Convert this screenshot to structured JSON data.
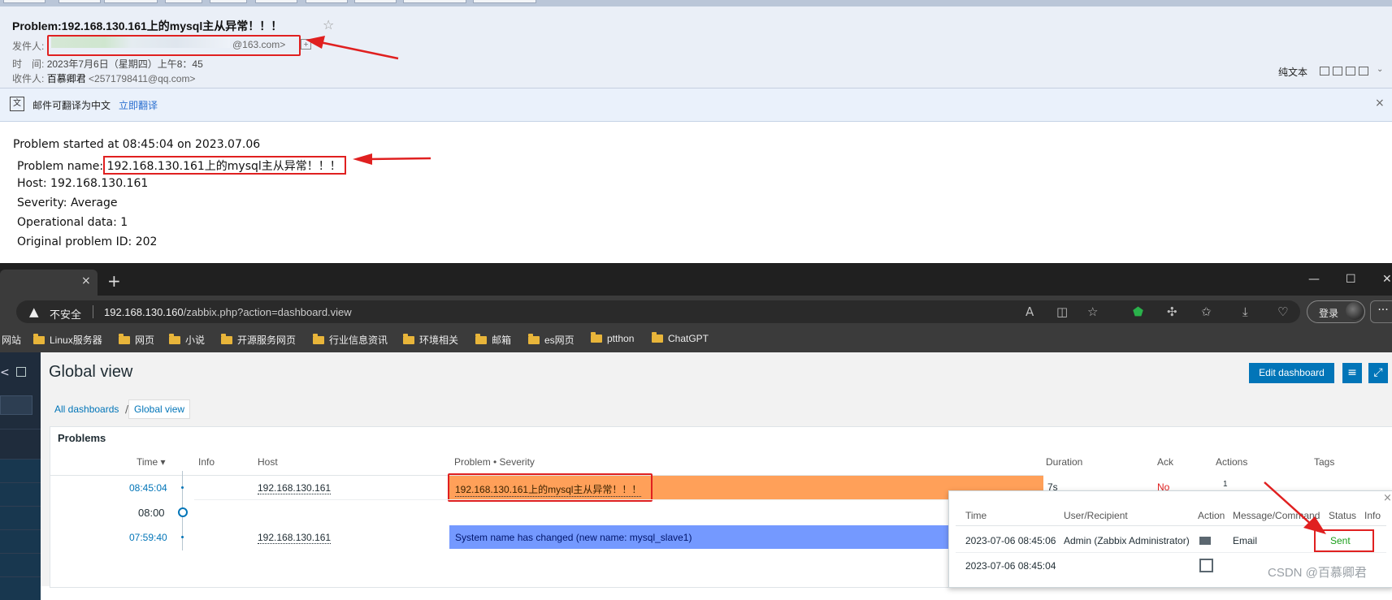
{
  "email": {
    "subject": "Problem:192.168.130.161上的mysql主从异常！！！",
    "star_icon": "☆",
    "from_label": "发件人:",
    "from_email": "@163.com>",
    "time_label": "时　间:",
    "time_value": "2023年7月6日（星期四）上午8：45",
    "to_label": "收件人:",
    "to_name": "百慕卿君",
    "to_email": "<2571798411@qq.com>",
    "plain_text": "纯文本",
    "translate_text": "邮件可翻译为中文",
    "translate_link": "立即翻译",
    "close_icon": "×",
    "body": {
      "started": "Problem started at 08:45:04 on 2023.07.06",
      "name_label": "Problem name: ",
      "name_value": "192.168.130.161上的mysql主从异常！！！",
      "host": "Host: 192.168.130.161",
      "severity": "Severity: Average",
      "opdata": "Operational data: 1",
      "original_id": "Original problem ID: 202"
    }
  },
  "browser": {
    "tab_close": "×",
    "new_tab": "+",
    "minimize": "—",
    "maximize": "☐",
    "close": "✕",
    "insecure_label": "不安全",
    "url_host": "192.168.130.160",
    "url_path": "/zabbix.php?action=dashboard.view",
    "login_label": "登录",
    "more_label": "···",
    "bookmarks": [
      "网站",
      "Linux服务器",
      "网页",
      "小说",
      "开源服务网页",
      "行业信息资讯",
      "环境相关",
      "邮箱",
      "es网页",
      "ptthon",
      "ChatGPT"
    ]
  },
  "zabbix": {
    "page_title": "Global view",
    "edit_dashboard": "Edit dashboard",
    "breadcrumb_all": "All dashboards",
    "breadcrumb_sep": "/",
    "breadcrumb_current": "Global view",
    "widget_title": "Problems",
    "columns": {
      "time": "Time ▾",
      "info": "Info",
      "host": "Host",
      "problem": "Problem • Severity",
      "duration": "Duration",
      "ack": "Ack",
      "actions": "Actions",
      "tags": "Tags"
    },
    "rows": [
      {
        "time": "08:45:04",
        "host": "192.168.130.161",
        "problem": "192.168.130.161上的mysql主从异常！！！",
        "duration": "7s",
        "ack": "No",
        "actions": "1",
        "severity_color": "#ffa059"
      },
      {
        "time": "07:59:40",
        "host": "192.168.130.161",
        "problem": "System name has changed (new name: mysql_slave1)",
        "severity_color": "#7499ff"
      }
    ],
    "timeline_marker": "08:00",
    "popup": {
      "columns": {
        "time": "Time",
        "user": "User/Recipient",
        "action": "Action",
        "message": "Message/Command",
        "status": "Status",
        "info": "Info"
      },
      "rows": [
        {
          "time": "2023-07-06 08:45:06",
          "user": "Admin (Zabbix Administrator)",
          "action_icon": "mail-icon",
          "message": "Email",
          "status": "Sent"
        },
        {
          "time": "2023-07-06 08:45:04",
          "action_icon": "calendar-icon"
        }
      ]
    }
  },
  "watermark": "CSDN @百慕卿君",
  "colors": {
    "accent": "#0275b8",
    "highlight": "#e02020",
    "status_sent": "#1a9e1a"
  }
}
